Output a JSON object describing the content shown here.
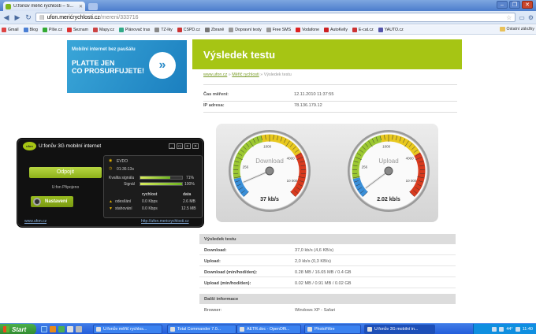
{
  "browser": {
    "tab_title": "U:fonův měřič rychlosti – S...",
    "url_host": "ufon.merićrychlosti.cz",
    "url_path": "/mereni/333716"
  },
  "bookmarks": [
    {
      "label": "Gmail",
      "color": "#d44"
    },
    {
      "label": "Blog",
      "color": "#4a7fd4"
    },
    {
      "label": "Píše.cz",
      "color": "#3a3"
    },
    {
      "label": "Seznam",
      "color": "#d33"
    },
    {
      "label": "Mapy.cz",
      "color": "#c44"
    },
    {
      "label": "Plánovač tras",
      "color": "#3a8"
    },
    {
      "label": "TZ-lky",
      "color": "#888"
    },
    {
      "label": "CSPD.cz",
      "color": "#c33"
    },
    {
      "label": "Zbraně",
      "color": "#777"
    },
    {
      "label": "Dopravní testy",
      "color": "#999"
    },
    {
      "label": "Free SMS",
      "color": "#999"
    },
    {
      "label": "Vodafone",
      "color": "#d22"
    },
    {
      "label": "AutoKelly",
      "color": "#c22"
    },
    {
      "label": "E-cat.cz",
      "color": "#c33"
    },
    {
      "label": "YAUTO.cz",
      "color": "#55a"
    }
  ],
  "bookmarks_other": "Ostatní záložky",
  "banner": {
    "line1": "Mobilní internet bez paušálu",
    "line2": "PLATTE JEN",
    "line3": "CO PROSURFUJETE!"
  },
  "page": {
    "heading": "Výsledek testu",
    "crumb1": "www.ufon.cz",
    "crumb2": "Měřič rychlosti",
    "crumb3": "Výsledek testu",
    "sep": "»",
    "time_label": "Čas měření:",
    "time_value": "12.11.2010 11:37:55",
    "ip_label": "IP adresa:",
    "ip_value": "78.136.179.12"
  },
  "gauges": [
    {
      "name": "Download",
      "value_text": "37 kb/s",
      "needle_fraction": 0.08
    },
    {
      "name": "Upload",
      "value_text": "2.02 kb/s",
      "needle_fraction": 0.03
    }
  ],
  "gauge_ticks": [
    "256",
    "1000",
    "4000",
    "10 000"
  ],
  "results": {
    "section1": "Výsledek testu",
    "rows": [
      {
        "k": "Download:",
        "v": "37,0 kb/s (4,6 KB/s)"
      },
      {
        "k": "Upload:",
        "v": "2,0 kb/s (0,3 KB/s)"
      },
      {
        "k": "Download (min/hod/den):",
        "v": "0.28 MB / 16.65 MB / 0.4 GB"
      },
      {
        "k": "Upload (min/hod/den):",
        "v": "0.02 MB / 0.91 MB / 0.02 GB"
      }
    ],
    "section2": "Další informace",
    "browser_label": "Browser:",
    "browser_value": "Windows XP - Safari"
  },
  "widget": {
    "title": "U:fonův 3G mobilní internet",
    "logo": "ufon",
    "connect": "Odpojit",
    "status": "U:fon Připojeno",
    "settings": "Nastavení",
    "link_left": "www.ufon.cz",
    "link_right": "http://ufon.mericrychlosti.cz",
    "mode": "EVDO",
    "timer": "01:36:13s",
    "signal_quality_label": "Kvalita signálu",
    "signal_quality_pct": "71%",
    "signal_quality_fraction": 0.71,
    "signal_label": "Signál",
    "signal_pct": "100%",
    "signal_fraction": 1.0,
    "col_speed": "rychlost",
    "col_data": "data",
    "send_label": "odesílání",
    "send_speed": "0.0 Kbps",
    "send_data": "2.6 MB",
    "recv_label": "stahování",
    "recv_speed": "0.0 Kbps",
    "recv_data": "12.5 MB"
  },
  "taskbar": {
    "start": "Start",
    "tasks": [
      {
        "label": "U:fonův měřič rychlos...",
        "active": false
      },
      {
        "label": "Total Commander 7.0...",
        "active": false
      },
      {
        "label": "AETR.doc - OpenOffi...",
        "active": false
      },
      {
        "label": "PhotoFiltre",
        "active": false
      },
      {
        "label": "U:fonův 3G mobilní in...",
        "active": true
      }
    ],
    "temp": "44°",
    "clock": "11:40"
  }
}
